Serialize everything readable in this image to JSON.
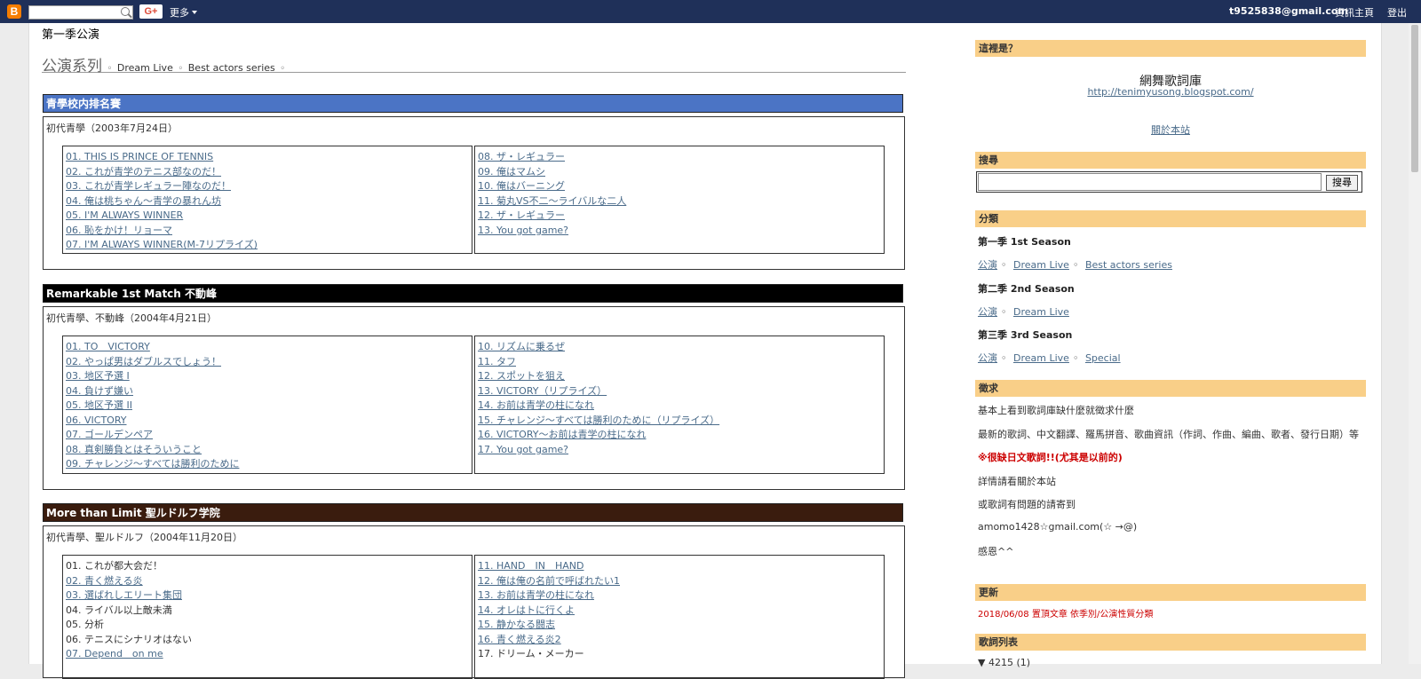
{
  "navbar": {
    "logo": "B",
    "gplus": "G+",
    "more": "更多",
    "email": "t9525838@gmail.com",
    "dashboard": "資訊主頁",
    "logout": "登出"
  },
  "post": {
    "title": "第一季公演",
    "series_label": "公演系列",
    "series_sep": "◦",
    "series_links": [
      "Dream Live",
      "Best actors series"
    ]
  },
  "sections": [
    {
      "header": "青學校内排名賽",
      "color": "#4b74c5",
      "info": "初代青學（2003年7月24日）",
      "left": [
        {
          "t": "01. THIS IS PRINCE OF TENNIS",
          "link": true
        },
        {
          "t": "02. これが青学のテニス部なのだ！",
          "link": true
        },
        {
          "t": "03. これが青学レギュラー陣なのだ！",
          "link": true
        },
        {
          "t": "04. 俺は桃ちゃん～青学の暴れん坊",
          "link": true
        },
        {
          "t": "05. I'M ALWAYS WINNER",
          "link": true
        },
        {
          "t": "06. 恥をかけ！リョーマ",
          "link": true
        },
        {
          "t": "07. I'M ALWAYS WINNER(M-7リプライズ)",
          "link": true
        }
      ],
      "right": [
        {
          "t": "08. ザ・レギュラー",
          "link": true
        },
        {
          "t": "09. 俺はマムシ",
          "link": true
        },
        {
          "t": "10. 俺はバーニング",
          "link": true
        },
        {
          "t": "11. 菊丸VS不二～ライバルな二人",
          "link": true
        },
        {
          "t": "12. ザ・レギュラー",
          "link": true
        },
        {
          "t": "13. You got game?",
          "link": true
        }
      ]
    },
    {
      "header": "Remarkable 1st Match 不動峰",
      "color": "#000000",
      "info": "初代青學、不動峰（2004年4月21日）",
      "left": [
        {
          "t": "01. TO　VICTORY",
          "link": true
        },
        {
          "t": "02. やっぱ男はダブルスでしょう！",
          "link": true
        },
        {
          "t": "03. 地区予選 I",
          "link": true
        },
        {
          "t": "04. 負けず嫌い",
          "link": true
        },
        {
          "t": "05. 地区予選 II",
          "link": true
        },
        {
          "t": "06. VICTORY",
          "link": true
        },
        {
          "t": "07. ゴールデンペア",
          "link": true
        },
        {
          "t": "08. 真剣勝負とはそういうこと",
          "link": true
        },
        {
          "t": "09. チャレンジ～すべては勝利のために",
          "link": true
        }
      ],
      "right": [
        {
          "t": "10. リズムに乗るぜ",
          "link": true
        },
        {
          "t": "11. タフ",
          "link": true
        },
        {
          "t": "12. スポットを狙え",
          "link": true
        },
        {
          "t": "13. VICTORY（リプライズ）",
          "link": true
        },
        {
          "t": "14. お前は青学の柱になれ",
          "link": true
        },
        {
          "t": "15. チャレンジ～すべては勝利のために（リプライズ）",
          "link": true
        },
        {
          "t": "16. VICTORY～お前は青学の柱になれ",
          "link": true
        },
        {
          "t": "17. You got game?",
          "link": true
        }
      ]
    },
    {
      "header": "More than Limit 聖ルドルフ学院",
      "color": "#3a1c0e",
      "info": "初代青學、聖ルドルフ（2004年11月20日）",
      "left": [
        {
          "t": "01. これが都大会だ！",
          "link": false
        },
        {
          "t": "02. 青く燃える炎",
          "link": true
        },
        {
          "t": "03. 選ばれしエリート集団",
          "link": true
        },
        {
          "t": "04. ライバル以上敵未満",
          "link": false
        },
        {
          "t": "05. 分析",
          "link": false
        },
        {
          "t": "06. テニスにシナリオはない",
          "link": false
        },
        {
          "t": "07. Depend　on me",
          "link": true
        }
      ],
      "right": [
        {
          "t": "11. HAND　IN　HAND",
          "link": true
        },
        {
          "t": "12. 俺は俺の名前で呼ばれたい1",
          "link": true
        },
        {
          "t": "13. お前は青学の柱になれ",
          "link": true
        },
        {
          "t": "14. オレはトに行くよ",
          "link": true
        },
        {
          "t": "15. 静かなる闘志",
          "link": true
        },
        {
          "t": "16. 青く燃える炎2",
          "link": true
        },
        {
          "t": "17. ドリーム・メーカー",
          "link": false
        }
      ]
    }
  ],
  "sidebar": {
    "about_head": "這裡是？",
    "site_name": "網舞歌詞庫",
    "site_url": "http://tenimyusong.blogspot.com/",
    "about_link": "關於本站",
    "search_head": "搜尋",
    "search_button": "搜尋",
    "category_head": "分類",
    "seasons": [
      {
        "name": "第一季 1st Season",
        "links": [
          "公演",
          "Dream Live",
          "Best actors series"
        ]
      },
      {
        "name": "第二季 2nd Season",
        "links": [
          "公演",
          "Dream Live"
        ]
      },
      {
        "name": "第三季 3rd Season",
        "links": [
          "公演",
          "Dream Live",
          "Special"
        ]
      }
    ],
    "dot": "◦",
    "request_head": "徵求",
    "request_lines": [
      "基本上看到歌詞庫缺什麼就徵求什麼",
      "最新的歌詞、中文翻譯、羅馬拼音、歌曲資訊（作詞、作曲、編曲、歌者、發行日期）等",
      "※很缺日文歌詞!!(尤其是以前的)",
      "詳情請看關於本站",
      "或歌詞有問題的請寄到",
      "amomo1428☆gmail.com(☆ →@)",
      "感恩^^"
    ],
    "update_head": "更新",
    "update_text": "2018/06/08 置頂文章 依季別/公演性質分類",
    "lyrics_head": "歌詞列表",
    "lyrics_item": "▼ 4215 (1)"
  }
}
